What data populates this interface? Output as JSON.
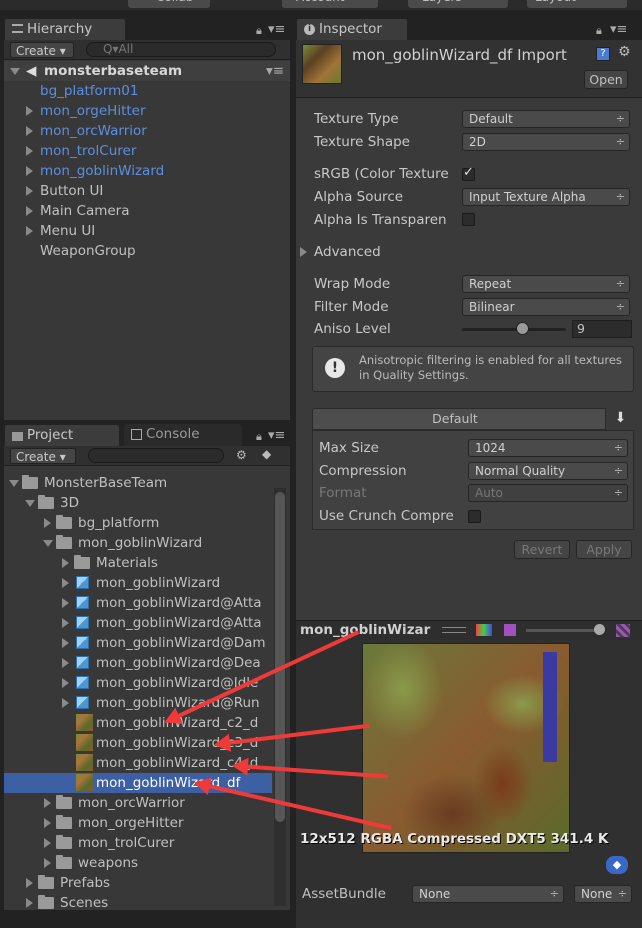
{
  "topbar": {
    "collab": "Collab",
    "account": "Account",
    "layers": "Layers",
    "layout": "Layout"
  },
  "hierarchy": {
    "tab": "Hierarchy",
    "create": "Create",
    "search_placeholder": "Q▾All",
    "scene": "monsterbaseteam",
    "items": [
      {
        "label": "bg_platform01",
        "prefab": true,
        "arrow": false
      },
      {
        "label": "mon_orgeHitter",
        "prefab": true,
        "arrow": true
      },
      {
        "label": "mon_orcWarrior",
        "prefab": true,
        "arrow": true
      },
      {
        "label": "mon_trolCurer",
        "prefab": true,
        "arrow": true
      },
      {
        "label": "mon_goblinWizard",
        "prefab": true,
        "arrow": true
      },
      {
        "label": "Button UI",
        "prefab": false,
        "arrow": true
      },
      {
        "label": "Main Camera",
        "prefab": false,
        "arrow": true
      },
      {
        "label": "Menu UI",
        "prefab": false,
        "arrow": true
      },
      {
        "label": "WeaponGroup",
        "prefab": false,
        "arrow": false
      }
    ]
  },
  "project": {
    "tab": "Project",
    "console_tab": "Console",
    "create": "Create",
    "items": [
      {
        "label": "MonsterBaseTeam",
        "kind": "folder",
        "exp": "d"
      },
      {
        "label": "3D",
        "kind": "folder",
        "exp": "d"
      },
      {
        "label": "bg_platform",
        "kind": "folder",
        "exp": "r"
      },
      {
        "label": "mon_goblinWizard",
        "kind": "folder",
        "exp": "d"
      },
      {
        "label": "Materials",
        "kind": "folder",
        "exp": "r"
      },
      {
        "label": "mon_goblinWizard",
        "kind": "mesh",
        "exp": "r"
      },
      {
        "label": "mon_goblinWizard@Atta",
        "kind": "mesh",
        "exp": "r"
      },
      {
        "label": "mon_goblinWizard@Atta",
        "kind": "mesh",
        "exp": "r"
      },
      {
        "label": "mon_goblinWizard@Dam",
        "kind": "mesh",
        "exp": "r"
      },
      {
        "label": "mon_goblinWizard@Dea",
        "kind": "mesh",
        "exp": "r"
      },
      {
        "label": "mon_goblinWizard@Idle",
        "kind": "mesh",
        "exp": "r"
      },
      {
        "label": "mon_goblinWizard@Run",
        "kind": "mesh",
        "exp": "r"
      },
      {
        "label": "mon_goblinWizard_c2_d",
        "kind": "tex",
        "exp": ""
      },
      {
        "label": "mon_goblinWizard_c3_d",
        "kind": "tex",
        "exp": ""
      },
      {
        "label": "mon_goblinWizard_c4_d",
        "kind": "tex",
        "exp": ""
      },
      {
        "label": "mon_goblinWizard_df",
        "kind": "tex",
        "exp": "",
        "selected": true
      },
      {
        "label": "mon_orcWarrior",
        "kind": "folder",
        "exp": "r"
      },
      {
        "label": "mon_orgeHitter",
        "kind": "folder",
        "exp": "r"
      },
      {
        "label": "mon_trolCurer",
        "kind": "folder",
        "exp": "r"
      },
      {
        "label": "weapons",
        "kind": "folder",
        "exp": "r"
      },
      {
        "label": "Prefabs",
        "kind": "folder",
        "exp": "r"
      },
      {
        "label": "Scenes",
        "kind": "folder",
        "exp": "r"
      }
    ]
  },
  "inspector": {
    "tab": "Inspector",
    "title": "mon_goblinWizard_df Import",
    "open": "Open",
    "texture_type": {
      "label": "Texture Type",
      "value": "Default"
    },
    "texture_shape": {
      "label": "Texture Shape",
      "value": "2D"
    },
    "srgb": {
      "label": "sRGB (Color Texture",
      "checked": true
    },
    "alpha_source": {
      "label": "Alpha Source",
      "value": "Input Texture Alpha"
    },
    "alpha_transparent": {
      "label": "Alpha Is Transparen",
      "checked": false
    },
    "advanced": "Advanced",
    "wrap_mode": {
      "label": "Wrap Mode",
      "value": "Repeat"
    },
    "filter_mode": {
      "label": "Filter Mode",
      "value": "Bilinear"
    },
    "aniso": {
      "label": "Aniso Level",
      "value": "9",
      "level": 0.6
    },
    "info": "Anisotropic filtering is enabled for all textures in Quality Settings.",
    "platform_tab": "Default",
    "max_size": {
      "label": "Max Size",
      "value": "1024"
    },
    "compression": {
      "label": "Compression",
      "value": "Normal Quality"
    },
    "format": {
      "label": "Format",
      "value": "Auto"
    },
    "crunch": {
      "label": "Use Crunch Compre",
      "checked": false
    },
    "revert": "Revert",
    "apply": "Apply"
  },
  "preview": {
    "title": "mon_goblinWizar",
    "info": "12x512  RGBA Compressed DXT5   341.4 K",
    "assetbundle_label": "AssetBundle",
    "assetbundle_value": "None",
    "variant_value": "None"
  },
  "colors": {
    "selection": "#3d60a5",
    "prefab_text": "#5b8fe0",
    "arrow": "#f03a3a"
  }
}
